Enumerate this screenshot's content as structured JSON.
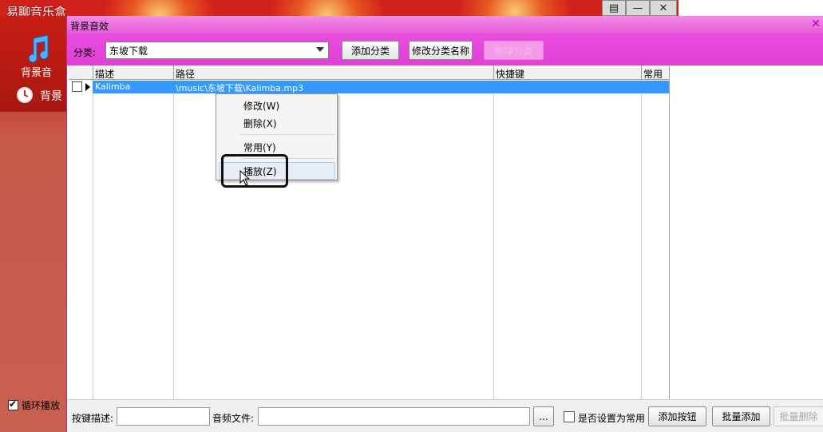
{
  "bg_app": {
    "title": "易聊音乐盒",
    "side_item_1": "背景音",
    "side_item_2": "背景",
    "loop_label": "循环播放",
    "icons": [
      "music-note-icon",
      "clock-icon",
      "restore-icon",
      "minimize-icon",
      "close-icon"
    ]
  },
  "dialog": {
    "title": "背景音效",
    "close_glyph": "✕"
  },
  "toolbar": {
    "category_label": "分类:",
    "category_value": "东坡下载",
    "add_category": "添加分类",
    "rename_category": "修改分类名称",
    "delete_category": "删除分类"
  },
  "grid": {
    "columns": [
      "描述",
      "路径",
      "快捷键",
      "常用"
    ],
    "rows": [
      {
        "desc": "Kalimba",
        "path": "\\music\\东坡下载\\Kalimba.mp3",
        "hotkey": "",
        "common": ""
      }
    ]
  },
  "context_menu": {
    "items": [
      "修改(W)",
      "删除(X)",
      "常用(Y)",
      "播放(Z)"
    ],
    "highlighted": "播放(Z)"
  },
  "bottom": {
    "key_desc_label": "按键描述:",
    "audio_file_label": "音频文件:",
    "browse": "...",
    "set_common": "是否设置为常用",
    "add_button": "添加按钮",
    "batch_add": "批量添加",
    "batch_delete": "批量删除"
  },
  "colors": {
    "dialog_title": "#e45ad8",
    "toolbar": "#e040d6",
    "selection": "#3399ff",
    "bg_app": "#d0201a"
  }
}
